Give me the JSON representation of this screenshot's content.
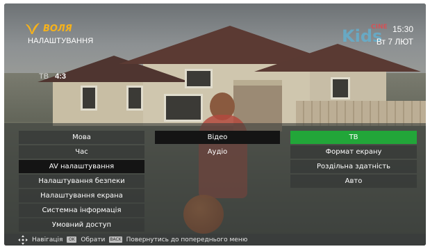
{
  "brand": {
    "logo_text": "ВОЛЯ",
    "logo_icon": "volia-v-logo-icon",
    "logo_color": "#f6b21b"
  },
  "header": {
    "title": "НАЛАШТУВАННЯ",
    "time": "15:30",
    "date": "Вт 7 ЛЮТ",
    "channel_logo_text": "Kids",
    "channel_logo_small": "CINE",
    "channel_logo_icon": "kids-cine-channel-logo"
  },
  "status": {
    "source_label": "ТВ",
    "aspect_value": "4:3"
  },
  "menu": {
    "column1": [
      {
        "label": "Мова",
        "state": "normal"
      },
      {
        "label": "Час",
        "state": "normal"
      },
      {
        "label": "AV налаштування",
        "state": "active"
      },
      {
        "label": "Налаштування безпеки",
        "state": "normal"
      },
      {
        "label": "Налаштування екрана",
        "state": "normal"
      },
      {
        "label": "Системна інформація",
        "state": "normal"
      },
      {
        "label": "Умовний доступ",
        "state": "normal"
      }
    ],
    "column2": [
      {
        "label": "Відео",
        "state": "active"
      },
      {
        "label": "Аудіо",
        "state": "normal"
      }
    ],
    "column3": [
      {
        "label": "ТВ",
        "state": "highlight"
      },
      {
        "label": "Формат екрану",
        "state": "normal"
      },
      {
        "label": "Роздільна здатність",
        "state": "normal"
      },
      {
        "label": "Авто",
        "state": "normal"
      }
    ]
  },
  "hints": {
    "navigate_icon": "dpad-arrows-icon",
    "navigate_label": "Навігація",
    "ok_key": "OK",
    "select_label": "Обрати",
    "back_key": "BACK",
    "back_label": "Повернутись до попереднього меню"
  },
  "colors": {
    "highlight": "#22a639",
    "active": "#141414",
    "text": "#ffffff"
  }
}
